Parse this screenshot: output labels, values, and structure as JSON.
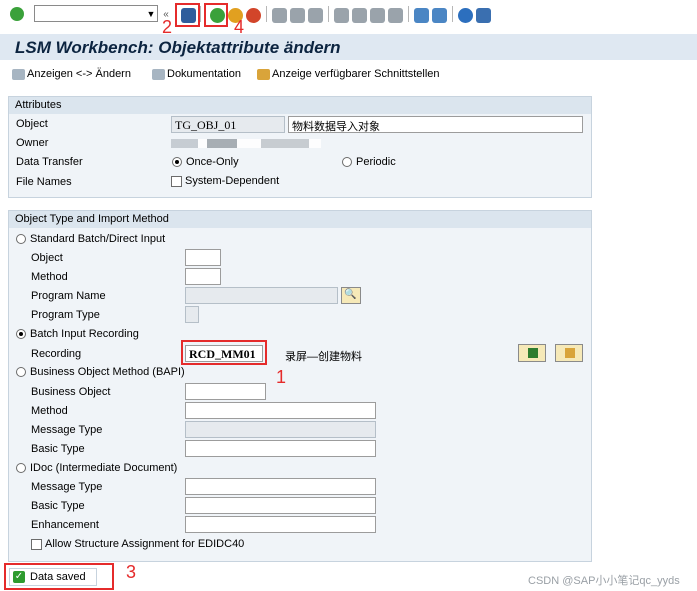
{
  "toolbar": {
    "command_field_value": "",
    "icons": [
      "enter-icon",
      "save-icon",
      "back-icon",
      "exit-icon",
      "cancel-icon",
      "print-icon",
      "find-icon",
      "find-next-icon",
      "first-page-icon",
      "previous-page-icon",
      "next-page-icon",
      "last-page-icon",
      "create-session-icon",
      "shortcut-icon",
      "help-icon",
      "customize-icon"
    ]
  },
  "title": "LSM Workbench: Objektattribute ändern",
  "app_toolbar": {
    "display_change": "Anzeigen <-> Ändern",
    "documentation": "Dokumentation",
    "interfaces": "Anzeige verfügbarer Schnittstellen"
  },
  "attributes": {
    "header": "Attributes",
    "object_label": "Object",
    "object_value": "TG_OBJ_01",
    "object_desc": "物料数据导入对象",
    "owner_label": "Owner",
    "data_transfer_label": "Data Transfer",
    "once_only": "Once-Only",
    "periodic": "Periodic",
    "file_names_label": "File Names",
    "system_dependent": "System-Dependent"
  },
  "import_method": {
    "header": "Object Type and Import Method",
    "standard_batch": "Standard Batch/Direct Input",
    "sb_object": "Object",
    "sb_method": "Method",
    "sb_program_name": "Program Name",
    "sb_program_type": "Program Type",
    "batch_input_recording": "Batch Input Recording",
    "recording_label": "Recording",
    "recording_value": "RCD_MM01",
    "recording_desc": "录屏—创建物料",
    "bapi": "Business Object Method  (BAPI)",
    "bapi_business_object": "Business Object",
    "bapi_method": "Method",
    "bapi_message_type": "Message Type",
    "bapi_basic_type": "Basic Type",
    "idoc": "IDoc (Intermediate Document)",
    "idoc_message_type": "Message Type",
    "idoc_basic_type": "Basic Type",
    "idoc_enhancement": "Enhancement",
    "allow_structure": "Allow Structure Assignment for EDIDC40"
  },
  "status": {
    "message": "Data saved"
  },
  "annotations": {
    "n1": "1",
    "n2": "2",
    "n3": "3",
    "n4": "4"
  },
  "watermark": "CSDN @SAP小小笔记qc_yyds",
  "colors": {
    "title_bg": "#dfe8f2",
    "group_bg": "#f0f4f8",
    "annotation_red": "#e52b2b",
    "status_green": "#2e9b2e"
  }
}
